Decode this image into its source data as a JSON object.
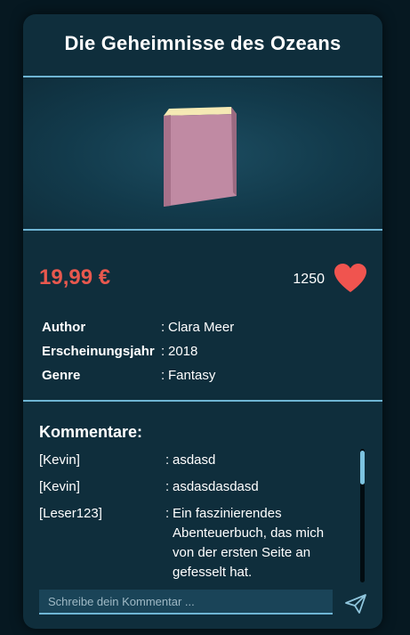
{
  "book": {
    "title": "Die Geheimnisse des Ozeans",
    "price": "19,99 €",
    "likes": "1250"
  },
  "details": [
    {
      "label": "Author",
      "separator": ":",
      "value": "Clara Meer"
    },
    {
      "label": "Erscheinungsjahr",
      "separator": ":",
      "value": "2018"
    },
    {
      "label": "Genre",
      "separator": ":",
      "value": "Fantasy"
    }
  ],
  "comments": {
    "heading": "Kommentare:",
    "items": [
      {
        "user": "[Kevin]",
        "separator": ":",
        "text": "asdasd"
      },
      {
        "user": "[Kevin]",
        "separator": ":",
        "text": "asdasdasdasd"
      },
      {
        "user": "[Leser123]",
        "separator": ":",
        "text": "Ein faszinierendes Abenteuerbuch, das mich von der ersten Seite an gefesselt hat."
      }
    ],
    "input_placeholder": "Schreibe dein Kommentar ..."
  },
  "icons": {
    "cover": "book-icon",
    "like": "heart-icon",
    "send": "send-icon"
  },
  "colors": {
    "background": "#061821",
    "card": "#0f2e3c",
    "accent": "#6fb5d4",
    "price": "#e8584e",
    "heart": "#f0544f",
    "book_cover": "#c08aa3",
    "book_pages": "#f5e9b4"
  }
}
